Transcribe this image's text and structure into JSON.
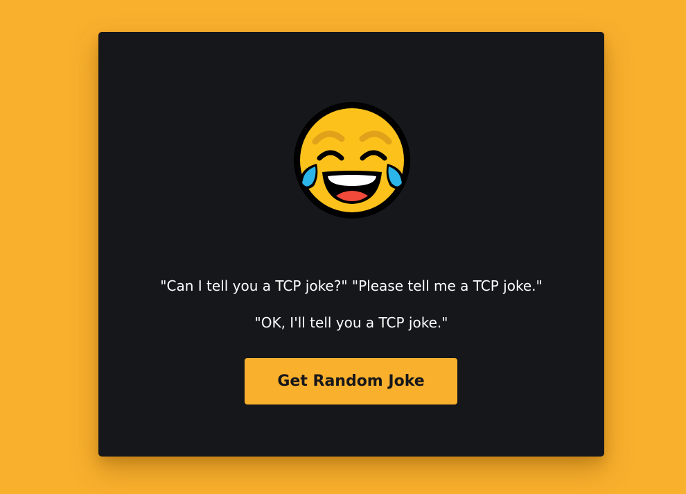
{
  "background_color": "#f9b02d",
  "card": {
    "background_color": "#16171b",
    "emoji_icon": "face-with-tears-of-joy-icon",
    "joke": {
      "line1": "\"Can I tell you a TCP joke?\" \"Please tell me a TCP joke.\"",
      "line2": "\"OK, I'll tell you a TCP joke.\""
    },
    "button": {
      "label": "Get Random Joke",
      "color": "#f9b02d"
    }
  }
}
